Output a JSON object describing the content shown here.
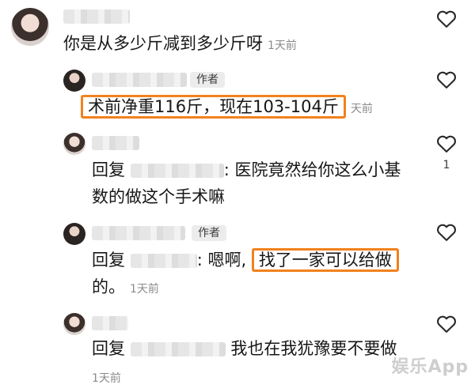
{
  "colors": {
    "highlight": "#f2811d",
    "meta_gray": "#8a8a8a",
    "badge_bg": "#ececec"
  },
  "comments": [
    {
      "text": "你是从多少斤减到多少斤呀",
      "time": "1天前"
    },
    {
      "badge": "作者",
      "text": "术前净重116斤，现在103-104斤",
      "time": "天前"
    },
    {
      "reply_prefix": "回复",
      "line1": ": 医院竟然给你这么小基",
      "line2": "数的做这个手术嘛",
      "likes": "1"
    },
    {
      "badge": "作者",
      "reply_prefix": "回复",
      "line1_a": ": 嗯啊,",
      "line1_highlight": "找了一家可以给做",
      "line2": "的。",
      "time": "1天前"
    },
    {
      "reply_prefix": "回复",
      "line1": "我也在我犹豫要不要做",
      "time": "1天前"
    }
  ],
  "watermark": "娱乐App",
  "icons": {
    "like": "heart-outline-icon",
    "avatar": "user-avatar"
  }
}
